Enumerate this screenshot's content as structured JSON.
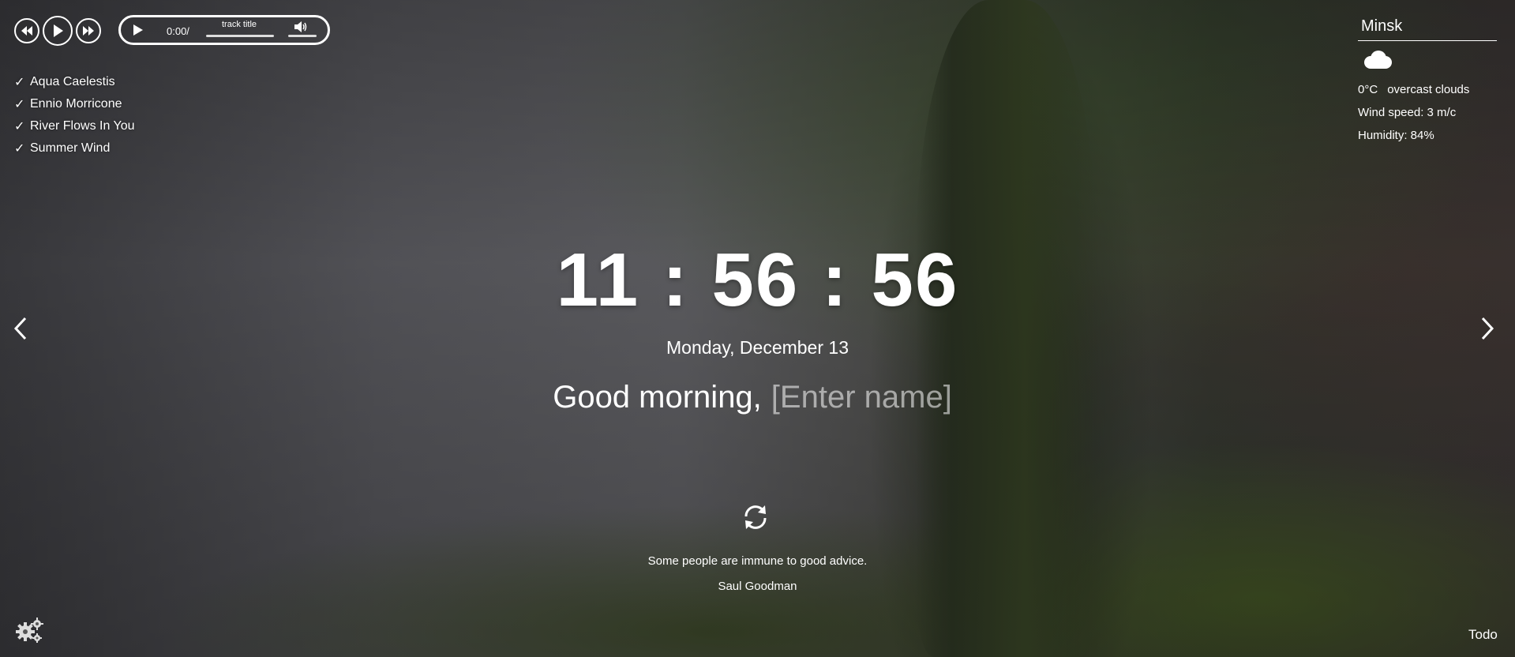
{
  "player": {
    "time": "0:00/",
    "track_title": "track title",
    "playlist": [
      {
        "title": "Aqua Caelestis"
      },
      {
        "title": "Ennio Morricone"
      },
      {
        "title": "River Flows In You"
      },
      {
        "title": "Summer Wind"
      }
    ]
  },
  "weather": {
    "city": "Minsk",
    "temperature": "0°C",
    "description": "overcast clouds",
    "wind": "Wind speed: 3 m/c",
    "humidity": "Humidity: 84%",
    "icon": "cloud-icon"
  },
  "clock": {
    "time": "11:56:56",
    "date": "Monday, December 13"
  },
  "greeting": {
    "text": "Good morning,",
    "name_placeholder": "[Enter name]"
  },
  "quote": {
    "text": "Some people are immune to good advice.",
    "author": "Saul Goodman"
  },
  "footer": {
    "todo_label": "Todo"
  },
  "icons": {
    "prev": "chevron-left-icon",
    "next": "chevron-right-icon",
    "refresh": "refresh-icon",
    "settings": "gear-icon"
  }
}
